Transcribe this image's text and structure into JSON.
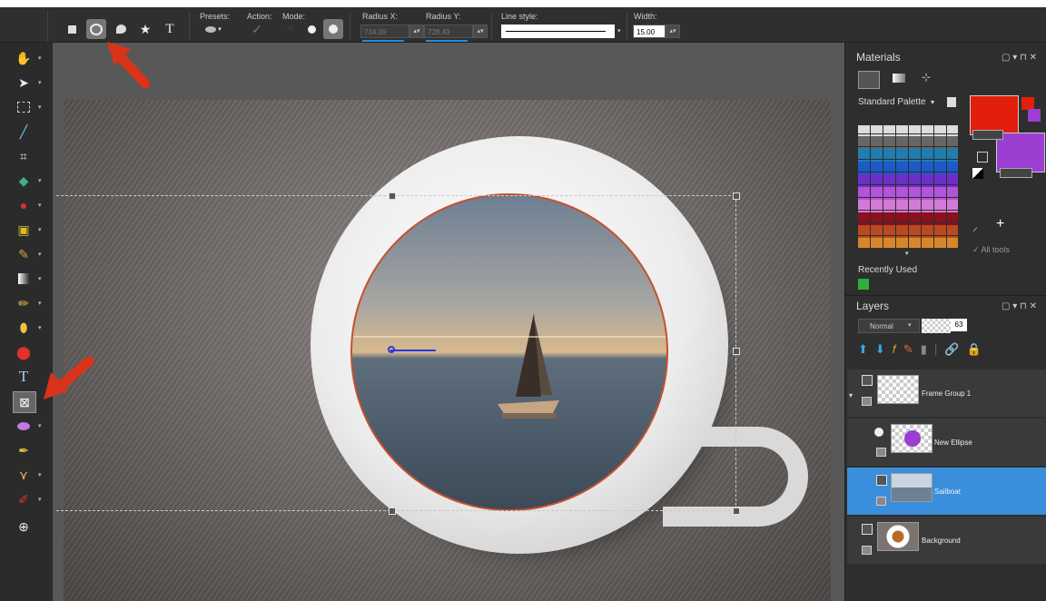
{
  "toolbar": {
    "presets_label": "Presets:",
    "action_label": "Action:",
    "mode_label": "Mode:",
    "radius_x_label": "Radius X:",
    "radius_x_value": "734.09",
    "radius_y_label": "Radius Y:",
    "radius_y_value": "728.49",
    "line_style_label": "Line style:",
    "width_label": "Width:",
    "width_value": "15.00",
    "shape_tools": [
      "rectangle-icon",
      "ellipse-icon",
      "bubble-icon",
      "star-icon",
      "text-T-icon"
    ],
    "text_tool_glyph": "T"
  },
  "left_tools": [
    "hand-icon",
    "pointer-icon",
    "selection-icon",
    "eyedropper-icon",
    "crop-icon",
    "straighten-icon",
    "redeye-icon",
    "clone-icon",
    "paint-brush-icon",
    "gradient-icon",
    "eraser-icon",
    "fill-icon",
    "color-picker-icon",
    "text-icon",
    "picture-frame-icon",
    "ellipse-shape-icon",
    "pen-icon",
    "vector-pen-icon",
    "dropper-icon",
    "add-icon"
  ],
  "text_tool_glyph": "T",
  "materials": {
    "title": "Materials",
    "palette_name": "Standard Palette",
    "all_tools_label": "All tools",
    "recently_used_label": "Recently Used",
    "foreground_color": "#e11f0a",
    "background_color": "#9b3ed1",
    "recent_colors": [
      "#8b2bd1",
      "#e11f0a",
      "#ffffff",
      "#222222",
      "#39c2e0",
      "#e83c8a",
      "#9be05a",
      "#2cb03c"
    ]
  },
  "layers": {
    "title": "Layers",
    "blend_mode": "Normal",
    "opacity": "63",
    "items": [
      {
        "name": "Frame Group 1"
      },
      {
        "name": "New Ellipse"
      },
      {
        "name": "Sailboat"
      },
      {
        "name": "Background"
      }
    ]
  },
  "colors": {
    "accent": "#3b8edb",
    "arrow": "#d9331a"
  }
}
